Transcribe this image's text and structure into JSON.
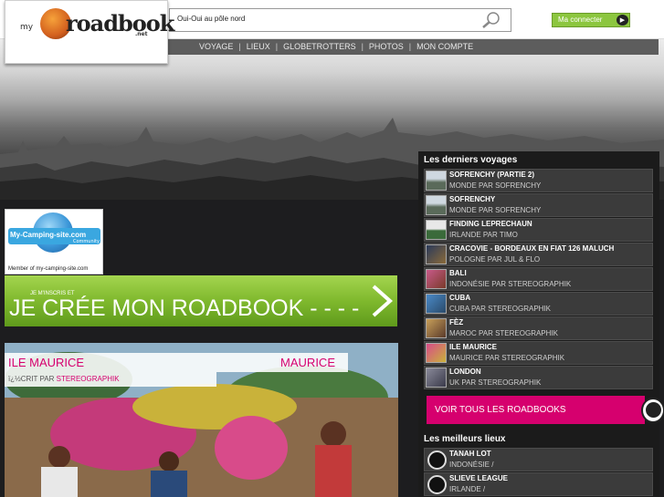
{
  "logo": {
    "prefix": "my",
    "text": "roadbook",
    "suffix": ".net"
  },
  "search": {
    "value": "Oui-Oui au pôle nord"
  },
  "login": {
    "label": "Ma connecter",
    "arrow": "▶"
  },
  "nav": {
    "items": [
      "VOYAGE",
      "LIEUX",
      "GLOBETROTTERS",
      "PHOTOS",
      "MON COMPTE"
    ]
  },
  "camping": {
    "brand": "My-Camping-site.com",
    "community": "Community",
    "caption": "Member of my-camping-site.com"
  },
  "cta": {
    "small": "JE M'INSCRIS ET",
    "big": "JE CRÉE MON ROADBOOK - - - -"
  },
  "feature": {
    "title": "ILE MAURICE",
    "country": "MAURICE",
    "written": "ï¿½CRIT PAR",
    "author": "STEREOGRAPHIK"
  },
  "latest": {
    "title": "Les derniers voyages",
    "items": [
      {
        "name": "SOFRENCHY (PARTIE 2)",
        "sub": "MONDE PAR SOFRENCHY"
      },
      {
        "name": "SOFRENCHY",
        "sub": "MONDE PAR SOFRENCHY"
      },
      {
        "name": "FINDING LEPRECHAUN",
        "sub": "IRLANDE PAR TIMO"
      },
      {
        "name": "CRACOVIE - BORDEAUX EN FIAT 126 MALUCH",
        "sub": "POLOGNE PAR JUL & FLO"
      },
      {
        "name": "BALI",
        "sub": "INDONÉSIE PAR STEREOGRAPHIK"
      },
      {
        "name": "CUBA",
        "sub": "CUBA PAR STEREOGRAPHIK"
      },
      {
        "name": "FÈZ",
        "sub": "MAROC PAR STEREOGRAPHIK"
      },
      {
        "name": "ILE MAURICE",
        "sub": "MAURICE PAR STEREOGRAPHIK"
      },
      {
        "name": "LONDON",
        "sub": "UK PAR STEREOGRAPHIK"
      }
    ],
    "see_all": "VOIR TOUS LES ROADBOOKS"
  },
  "best": {
    "title": "Les meilleurs lieux",
    "items": [
      {
        "name": "TANAH LOT",
        "sub": "INDONÉSIE /"
      },
      {
        "name": "SLIEVE LEAGUE",
        "sub": "IRLANDE /"
      }
    ]
  },
  "colors": {
    "accent": "#d6006e",
    "green": "#8cc63f"
  }
}
